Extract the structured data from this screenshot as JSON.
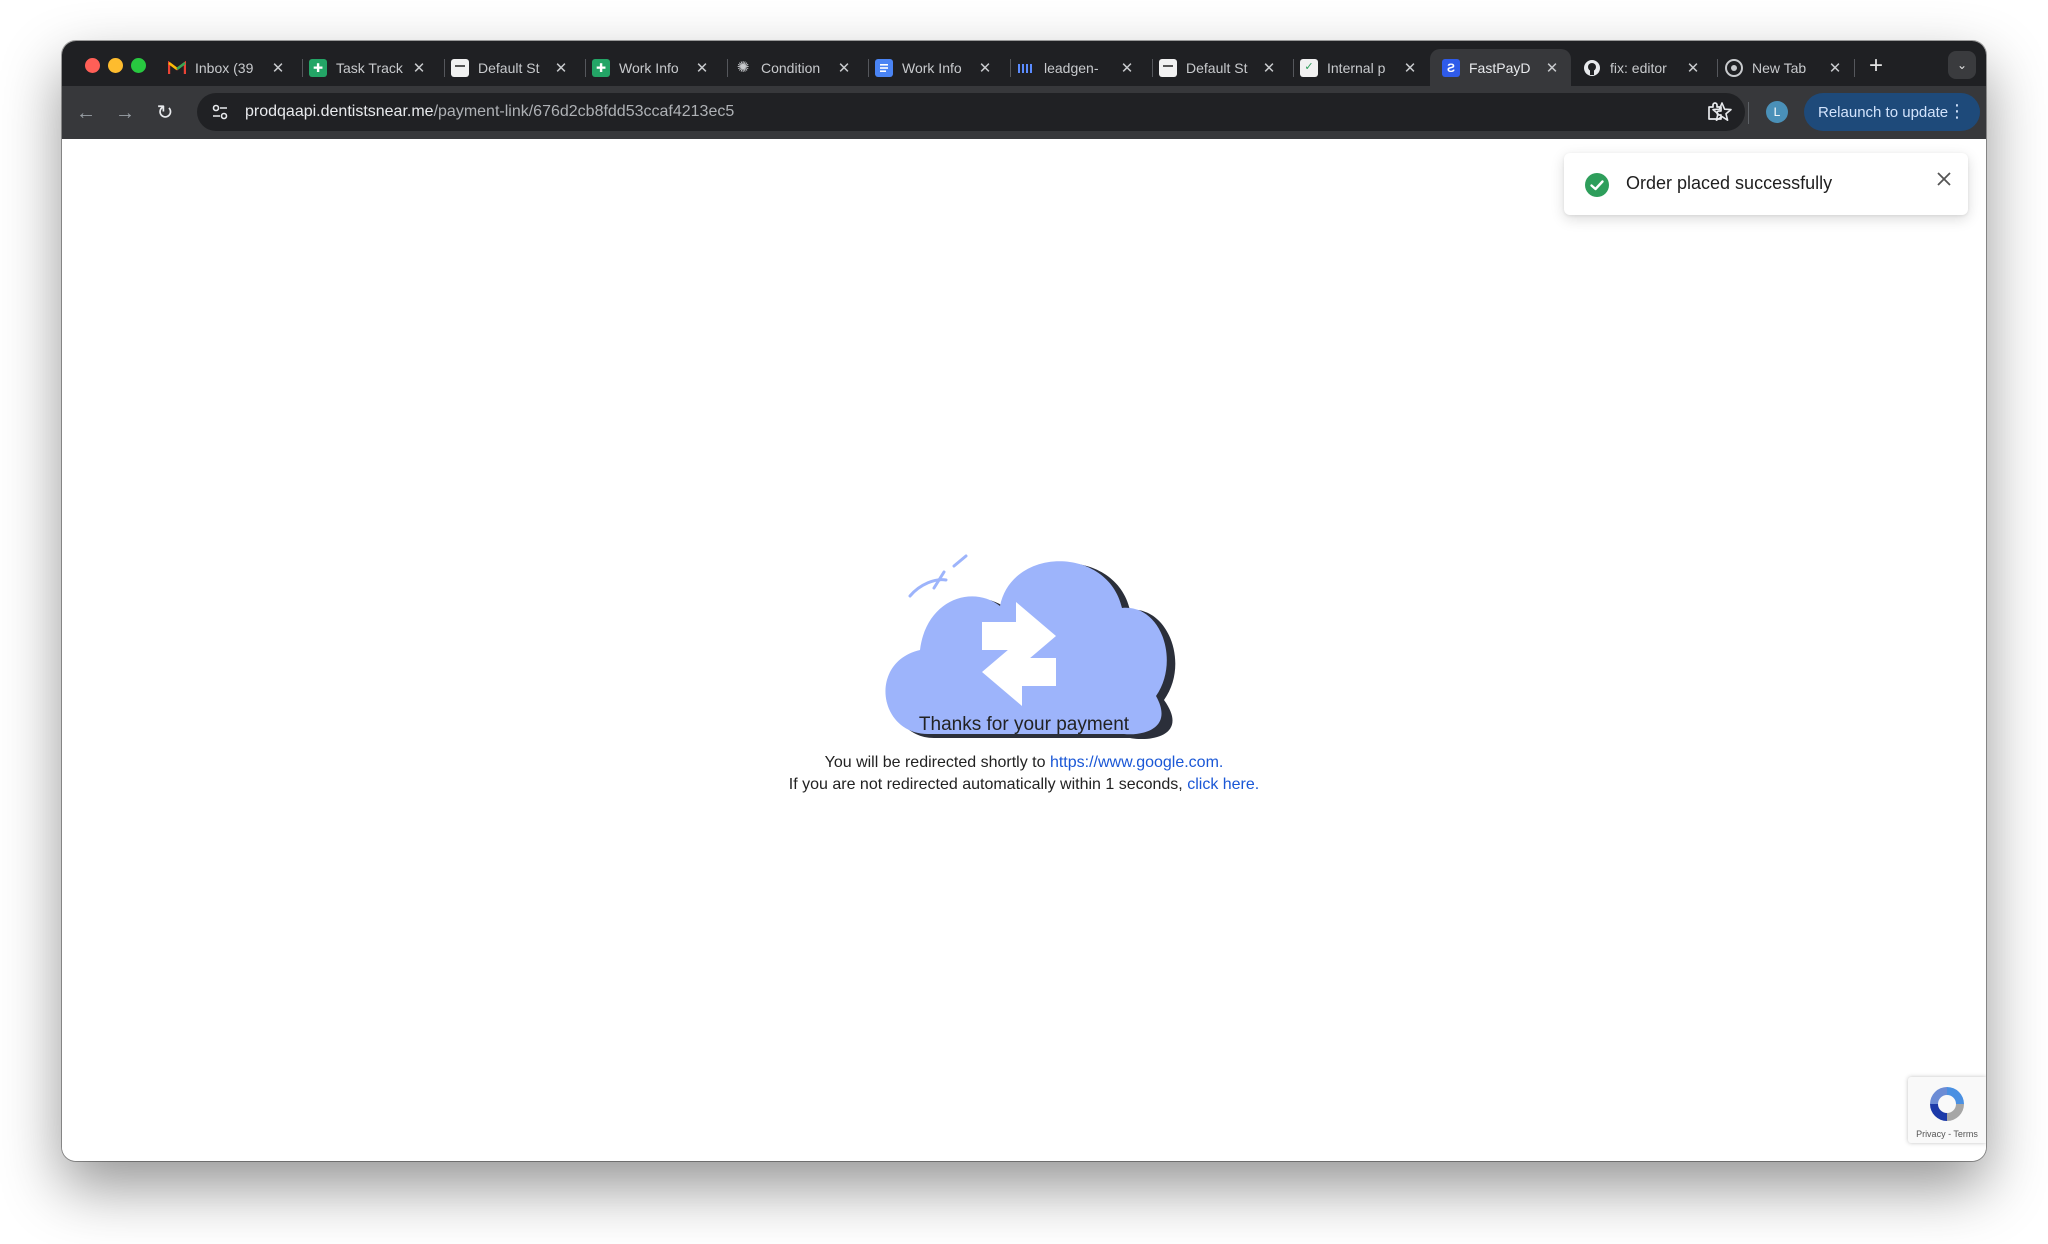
{
  "browser": {
    "tabs": [
      {
        "title": "Inbox (39",
        "favicon": "gmail-icon"
      },
      {
        "title": "Task Track",
        "favicon": "sheets-icon"
      },
      {
        "title": "Default St",
        "favicon": "document-icon"
      },
      {
        "title": "Work Info",
        "favicon": "sheets-icon"
      },
      {
        "title": "Condition",
        "favicon": "chatgpt-icon"
      },
      {
        "title": "Work Info",
        "favicon": "docs-icon"
      },
      {
        "title": "leadgen-",
        "favicon": "barcode-icon"
      },
      {
        "title": "Default St",
        "favicon": "document-icon"
      },
      {
        "title": "Internal p",
        "favicon": "shield-icon"
      },
      {
        "title": "FastPayD",
        "favicon": "fastpay-icon",
        "active": true
      },
      {
        "title": "fix: editor",
        "favicon": "github-icon"
      },
      {
        "title": "New Tab",
        "favicon": "chrome-icon"
      }
    ],
    "url_host": "prodqaapi.dentistsnear.me",
    "url_path": "/payment-link/676d2cb8fdd53ccaf4213ec5",
    "avatar_letter": "L",
    "relaunch_label": "Relaunch to update"
  },
  "toast": {
    "message": "Order placed successfully",
    "icon": "check-circle-icon",
    "color": "#2e9e5b"
  },
  "content": {
    "illustration": "cloud-transfer-icon",
    "accent_color": "#9db4fb",
    "heading": "Thanks for your payment",
    "redirect_text": "You will be redirected shortly to ",
    "redirect_url": "https://www.google.com.",
    "fallback_text": "If you are not redirected automatically within 1 seconds, ",
    "fallback_link": "click here."
  },
  "recaptcha": {
    "privacy": "Privacy",
    "separator": " - ",
    "terms": "Terms"
  }
}
